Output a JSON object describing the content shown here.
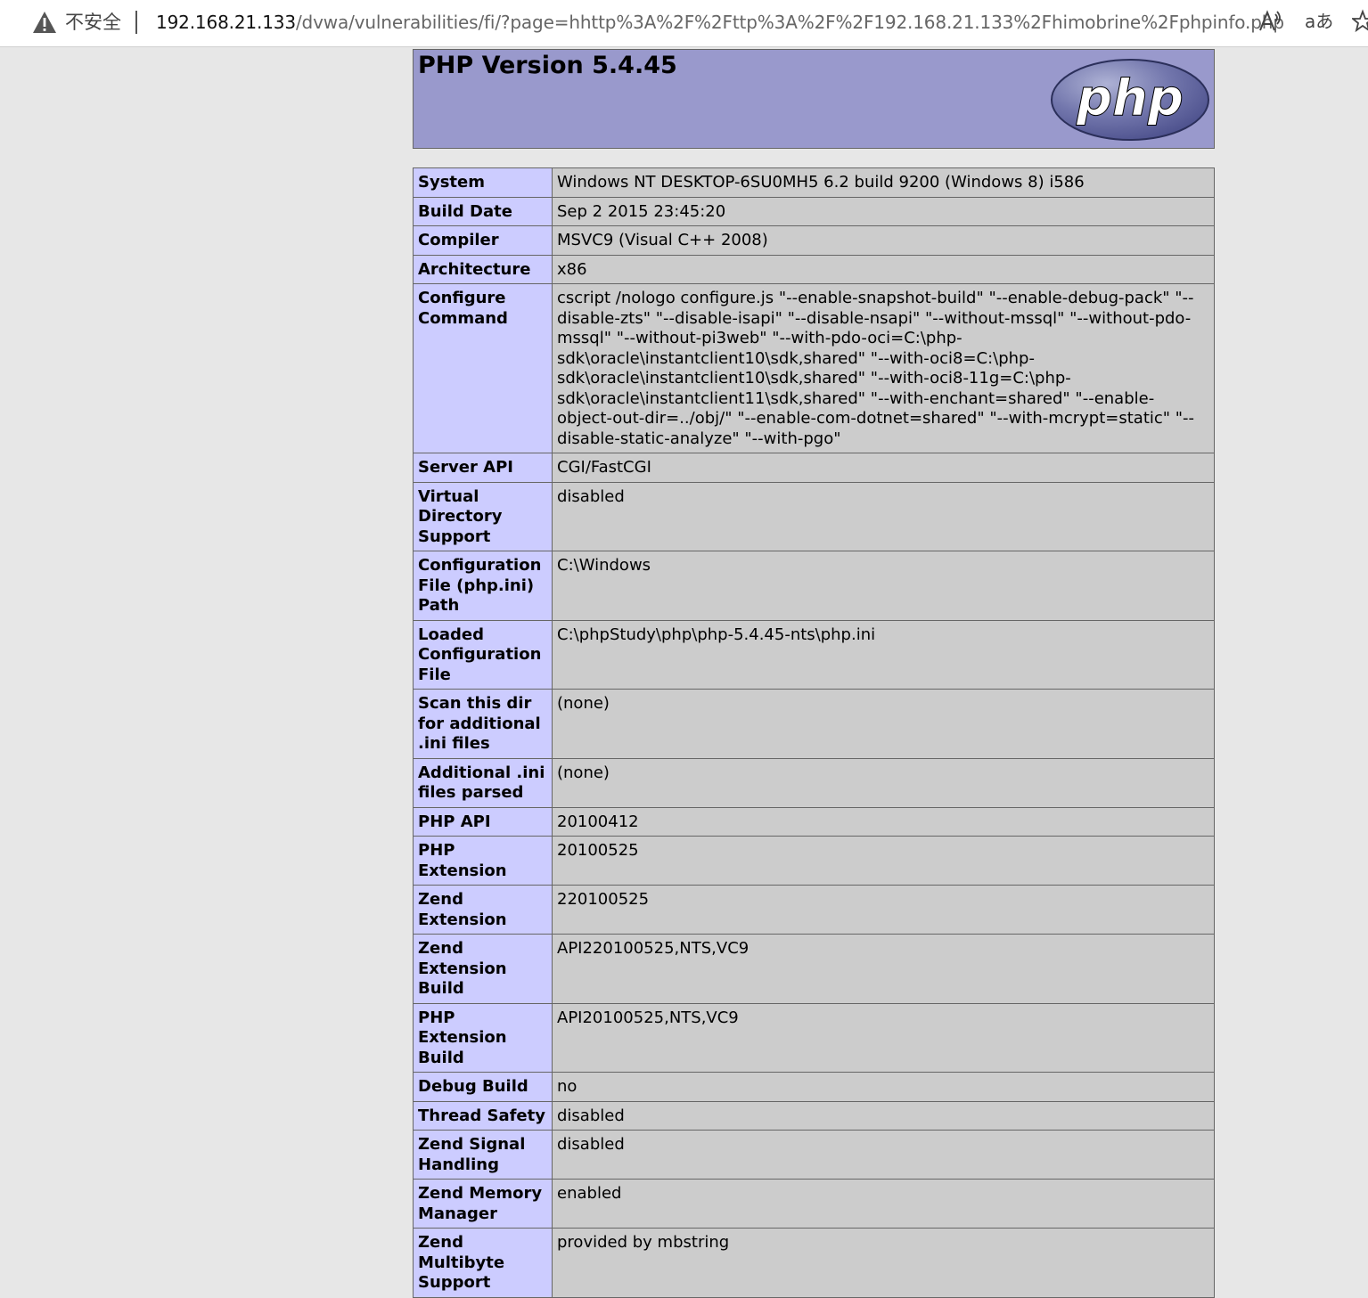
{
  "browser": {
    "security_label": "不安全",
    "url_host": "192.168.21.133",
    "url_path": "/dvwa/vulnerabilities/fi/?page=hhttp%3A%2F%2Fttp%3A%2F%2F192.168.21.133%2Fhimobrine%2Fphpinfo.php",
    "translate_label": "aあ"
  },
  "header": {
    "title": "PHP Version 5.4.45",
    "logo_text": "php"
  },
  "rows": [
    {
      "key": "System",
      "value": "Windows NT DESKTOP-6SU0MH5 6.2 build 9200 (Windows 8) i586"
    },
    {
      "key": "Build Date",
      "value": "Sep 2 2015 23:45:20"
    },
    {
      "key": "Compiler",
      "value": "MSVC9 (Visual C++ 2008)"
    },
    {
      "key": "Architecture",
      "value": "x86"
    },
    {
      "key": "Configure Command",
      "value": "cscript /nologo configure.js \"--enable-snapshot-build\" \"--enable-debug-pack\" \"--disable-zts\" \"--disable-isapi\" \"--disable-nsapi\" \"--without-mssql\" \"--without-pdo-mssql\" \"--without-pi3web\" \"--with-pdo-oci=C:\\php-sdk\\oracle\\instantclient10\\sdk,shared\" \"--with-oci8=C:\\php-sdk\\oracle\\instantclient10\\sdk,shared\" \"--with-oci8-11g=C:\\php-sdk\\oracle\\instantclient11\\sdk,shared\" \"--with-enchant=shared\" \"--enable-object-out-dir=../obj/\" \"--enable-com-dotnet=shared\" \"--with-mcrypt=static\" \"--disable-static-analyze\" \"--with-pgo\""
    },
    {
      "key": "Server API",
      "value": "CGI/FastCGI"
    },
    {
      "key": "Virtual Directory Support",
      "value": "disabled"
    },
    {
      "key": "Configuration File (php.ini) Path",
      "value": "C:\\Windows"
    },
    {
      "key": "Loaded Configuration File",
      "value": "C:\\phpStudy\\php\\php-5.4.45-nts\\php.ini"
    },
    {
      "key": "Scan this dir for additional .ini files",
      "value": "(none)"
    },
    {
      "key": "Additional .ini files parsed",
      "value": "(none)"
    },
    {
      "key": "PHP API",
      "value": "20100412"
    },
    {
      "key": "PHP Extension",
      "value": "20100525"
    },
    {
      "key": "Zend Extension",
      "value": "220100525"
    },
    {
      "key": "Zend Extension Build",
      "value": "API220100525,NTS,VC9"
    },
    {
      "key": "PHP Extension Build",
      "value": "API20100525,NTS,VC9"
    },
    {
      "key": "Debug Build",
      "value": "no"
    },
    {
      "key": "Thread Safety",
      "value": "disabled"
    },
    {
      "key": "Zend Signal Handling",
      "value": "disabled"
    },
    {
      "key": "Zend Memory Manager",
      "value": "enabled"
    },
    {
      "key": "Zend Multibyte Support",
      "value": "provided by mbstring"
    }
  ]
}
